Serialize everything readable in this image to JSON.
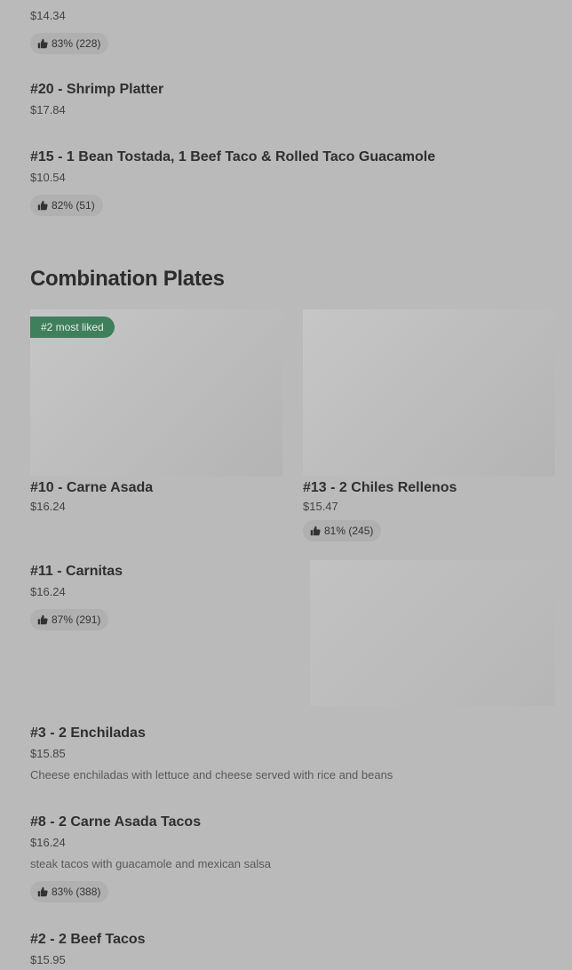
{
  "top_item": {
    "price": "$14.34",
    "rating": "83% (228)"
  },
  "items_top": [
    {
      "title": "#20 - Shrimp Platter",
      "price": "$17.84"
    },
    {
      "title": "#15 - 1 Bean Tostada, 1 Beef Taco & Rolled Taco Guacamole",
      "price": "$10.54",
      "rating": "82% (51)"
    }
  ],
  "section": {
    "title": "Combination Plates"
  },
  "cards": [
    {
      "badge": "#2 most liked",
      "title": "#10 - Carne Asada",
      "price": "$16.24"
    },
    {
      "title": "#13 - 2 Chiles Rellenos",
      "price": "$15.47",
      "rating": "81% (245)"
    }
  ],
  "items_bottom": [
    {
      "title": "#11 - Carnitas",
      "price": "$16.24",
      "rating": "87% (291)"
    },
    {
      "title": "#3 - 2 Enchiladas",
      "price": "$15.85",
      "description": "Cheese enchiladas with lettuce and cheese served with rice and beans"
    },
    {
      "title": "#8 - 2 Carne Asada Tacos",
      "price": "$16.24",
      "description": "steak tacos with guacamole and mexican salsa",
      "rating": "83% (388)"
    },
    {
      "title": "#2 - 2 Beef Tacos",
      "price": "$15.95"
    }
  ],
  "icons": {
    "rating": "thumbs-up-icon"
  },
  "colors": {
    "background": "#bababa",
    "badge": "#3e7f5c",
    "rating_pill": "#b0b0b0"
  }
}
